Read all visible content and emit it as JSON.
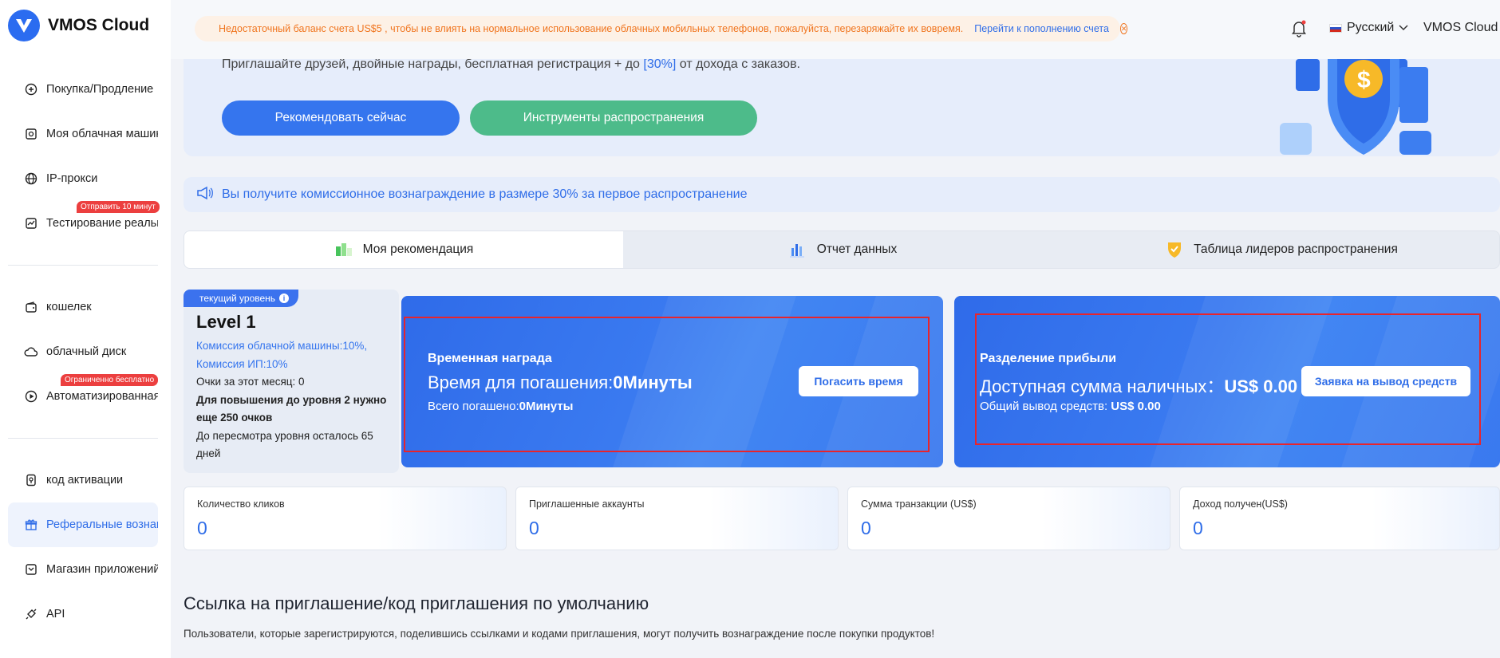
{
  "app": {
    "name": "VMOS Cloud"
  },
  "sidebar": {
    "items": [
      {
        "label": "Покупка/Продление",
        "icon": "plus-circle-icon"
      },
      {
        "label": "Моя облачная машина",
        "icon": "cloud-phone-icon"
      },
      {
        "label": "IP-прокси",
        "icon": "globe-icon"
      },
      {
        "label": "Тестирование реального",
        "icon": "chart-test-icon",
        "badge": "Отправить 10 минут"
      },
      {
        "label": "кошелек",
        "icon": "wallet-icon"
      },
      {
        "label": "облачный диск",
        "icon": "cloud-disk-icon"
      },
      {
        "label": "Автоматизированная оп",
        "icon": "play-circle-icon",
        "badge": "Ограниченно бесплатно"
      },
      {
        "label": "код активации",
        "icon": "activation-code-icon"
      },
      {
        "label": "Реферальные вознаграж",
        "icon": "gift-icon",
        "active": true
      },
      {
        "label": "Магазин приложений",
        "icon": "app-store-icon"
      },
      {
        "label": "API",
        "icon": "api-icon"
      }
    ]
  },
  "topbar": {
    "notice": "Недостаточный баланс счета US$5 , чтобы не влиять на нормальное использование облачных мобильных телефонов, пожалуйста, перезаряжайте их вовремя.",
    "notice_link": "Перейти к пополнению счета",
    "language": "Русский",
    "user": "VMOS Cloud"
  },
  "banner": {
    "subtitle_prefix": "Приглашайте друзей, двойные награды, бесплатная регистрация + до ",
    "subtitle_highlight": "[30%]",
    "subtitle_suffix": " от дохода с заказов.",
    "recommend_button": "Рекомендовать сейчас",
    "tools_button": "Инструменты распространения"
  },
  "commission_notice": "Вы получите комиссионное вознаграждение в размере 30% за первое распространение",
  "tabs": [
    {
      "label": "Моя рекомендация",
      "active": true
    },
    {
      "label": "Отчет данных",
      "active": false
    },
    {
      "label": "Таблица лидеров распространения",
      "active": false
    }
  ],
  "level": {
    "badge": "текущий уровень",
    "title": "Level 1",
    "commission_machine": "Комиссия облачной машины:10%,",
    "commission_ip": "Комиссия ИП:10%",
    "points_month": "Очки за этот месяц: 0",
    "upgrade_note": "Для повышения до уровня 2 нужно еще 250 очков",
    "review_note": "До пересмотра уровня осталось 65 дней"
  },
  "time_reward": {
    "title": "Временная награда",
    "main_label": "Время для погашения:",
    "main_value": "0Минуты",
    "sub_label": "Всего погашено:",
    "sub_value": "0Минуты",
    "button": "Погасить время"
  },
  "profit_share": {
    "title": "Разделение прибыли",
    "main_label": "Доступная сумма наличных：",
    "main_value": "US$ 0.00",
    "sub_label": "Общий вывод средств: ",
    "sub_value": "US$ 0.00",
    "button": "Заявка на вывод средств"
  },
  "stats": [
    {
      "label": "Количество кликов",
      "value": "0"
    },
    {
      "label": "Приглашенные аккаунты",
      "value": "0"
    },
    {
      "label": "Сумма транзакции (US$)",
      "value": "0"
    },
    {
      "label": "Доход получен(US$)",
      "value": "0"
    }
  ],
  "invite_section": {
    "title": "Ссылка на приглашение/код приглашения по умолчанию",
    "description": "Пользователи, которые зарегистрируются, поделившись ссылками и кодами приглашения, могут получить вознаграждение после покупки продуктов!"
  },
  "colors": {
    "accent": "#2f6de8",
    "tools_green": "#4dbb8a",
    "notice_orange": "#f0751f",
    "badge_red": "#ec3f3f",
    "highlight_red": "#e8242c"
  }
}
